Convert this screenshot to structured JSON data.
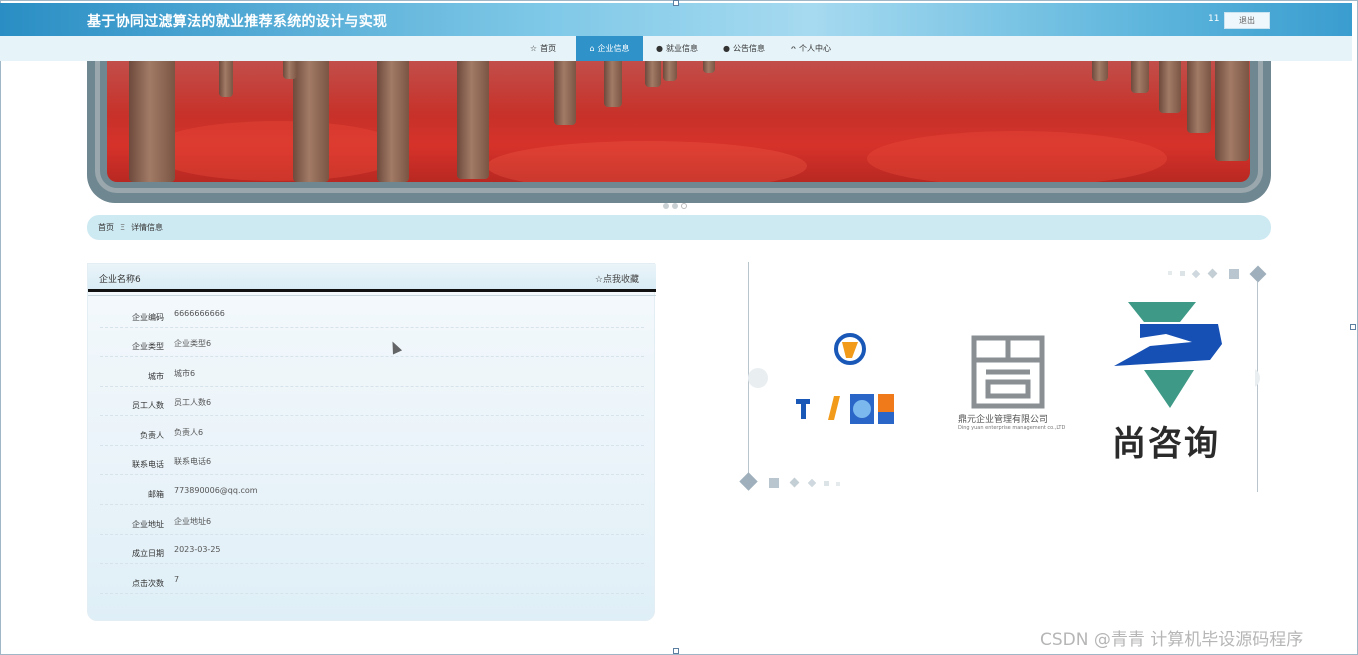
{
  "header": {
    "title": "基于协同过滤算法的就业推荐系统的设计与实现",
    "user": "11",
    "logout_label": "退出"
  },
  "nav": {
    "items": [
      {
        "icon": "☆",
        "label": "首页"
      },
      {
        "icon": "⌂",
        "label": "企业信息"
      },
      {
        "icon": "●",
        "label": "就业信息"
      },
      {
        "icon": "●",
        "label": "公告信息"
      },
      {
        "icon": "ᴖ",
        "label": "个人中心"
      }
    ],
    "active_index": 1
  },
  "breadcrumb": {
    "home": "首页",
    "separator": "Ξ",
    "current": "详情信息"
  },
  "detail": {
    "name": "企业名称6",
    "favorite_label": "☆点我收藏",
    "rows": [
      {
        "label": "企业编码",
        "value": "6666666666"
      },
      {
        "label": "企业类型",
        "value": "企业类型6"
      },
      {
        "label": "城市",
        "value": "城市6"
      },
      {
        "label": "员工人数",
        "value": "员工人数6"
      },
      {
        "label": "负责人",
        "value": "负责人6"
      },
      {
        "label": "联系电话",
        "value": "联系电话6"
      },
      {
        "label": "邮箱",
        "value": "773890006@qq.com"
      },
      {
        "label": "企业地址",
        "value": "企业地址6"
      },
      {
        "label": "成立日期",
        "value": "2023-03-25"
      },
      {
        "label": "点击次数",
        "value": "7"
      }
    ]
  },
  "logos": {
    "logo2_text": "鼎元企业管理有限公司",
    "logo2_sub": "Ding yuan enterprise management co.,LTD",
    "logo3_text": "尚咨询"
  },
  "watermark": "CSDN @青青  计算机毕设源码程序",
  "colors": {
    "accent": "#2f92c9",
    "header_start": "#2a8ec4",
    "banner_red": "#c73129"
  }
}
